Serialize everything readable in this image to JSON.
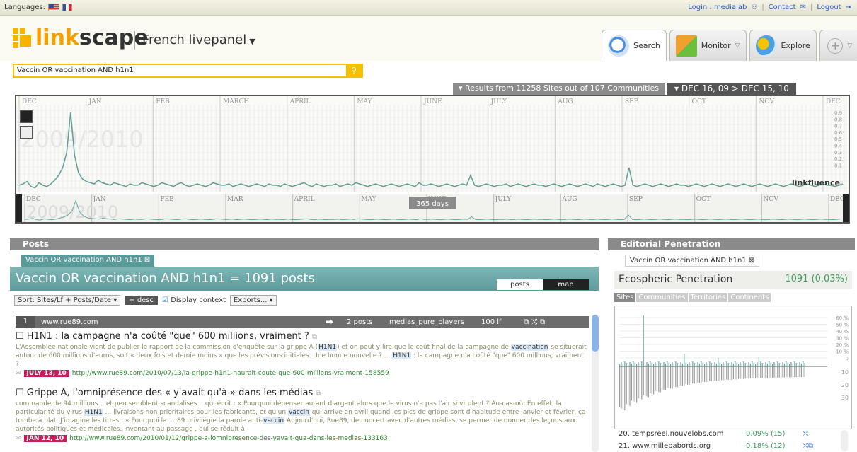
{
  "topbar": {
    "languages_label": "Languages:",
    "login": "Login : medialab",
    "contact": "Contact",
    "logout": "Logout",
    "separator": "|"
  },
  "header": {
    "logo_prefix": "link",
    "logo_suffix": "scape",
    "panel": "French livepanel",
    "tabs": [
      {
        "label": "Search"
      },
      {
        "label": "Monitor"
      },
      {
        "label": "Explore"
      }
    ]
  },
  "search": {
    "query": "Vaccin OR vaccination AND h1n1"
  },
  "results": {
    "summary": "Results from 11258 Sites out of 107 Communities",
    "date_range": "DEC 16, 09 > DEC 15, 10"
  },
  "timeline": {
    "months": [
      "DEC",
      "JAN",
      "FEB",
      "MARCH",
      "APRIL",
      "MAY",
      "JUNE",
      "JULY",
      "AUG",
      "SEP",
      "OCT",
      "NOV",
      "DEC"
    ],
    "mini_months": [
      "DEC",
      "JAN",
      "FEB",
      "MAR",
      "APRIL",
      "MAY",
      "JUNE",
      "JULY",
      "AUG",
      "SEP",
      "OCT",
      "NOV",
      "DEC"
    ],
    "year_watermark": "2009/2010",
    "mini_watermark": "2009/2010",
    "y_ticks": [
      "0.9",
      "0.8",
      "0.7",
      "0.6",
      "0.5",
      "0.4",
      "0.3",
      "0.2",
      "0.1"
    ],
    "brand": "linkfluence",
    "window_label": "365 days",
    "series": [
      4,
      5,
      7,
      3,
      2,
      6,
      4,
      3,
      5,
      8,
      12,
      18,
      30,
      62,
      28,
      14,
      9,
      7,
      6,
      5,
      8,
      6,
      5,
      4,
      6,
      5,
      4,
      3,
      5,
      4,
      4,
      6,
      5,
      4,
      3,
      4,
      6,
      5,
      4,
      3,
      5,
      6,
      4,
      3,
      4,
      5,
      4,
      3,
      4,
      6,
      5,
      4,
      4,
      5,
      3,
      4,
      5,
      4,
      3,
      4,
      5,
      4,
      3,
      5,
      4,
      4,
      3,
      5,
      4,
      3,
      4,
      5,
      6,
      4,
      3,
      5,
      4,
      3,
      4,
      4,
      5,
      3,
      4,
      5,
      4,
      6,
      5,
      4,
      3,
      4,
      5,
      4,
      3,
      4,
      5,
      4,
      3,
      4,
      5,
      4,
      3,
      6,
      4,
      4,
      5,
      4,
      3,
      4,
      5,
      4,
      3,
      4,
      5,
      4,
      12,
      4,
      3,
      4,
      5,
      4,
      3,
      4,
      4,
      5,
      3,
      4,
      5,
      4,
      3,
      4,
      5,
      4,
      4,
      3,
      4,
      5,
      4,
      3,
      4,
      5,
      4,
      3,
      4,
      5,
      4,
      3,
      5,
      4,
      3,
      4,
      5,
      4,
      3,
      4,
      18,
      4,
      3,
      4,
      5,
      4,
      3,
      4,
      5,
      4,
      3,
      4,
      5,
      4,
      4,
      3,
      4,
      5,
      4,
      3,
      4,
      5,
      4,
      3,
      4,
      5,
      4,
      3,
      4,
      5,
      4,
      3,
      4,
      5,
      4,
      3,
      4,
      5,
      4,
      3,
      4,
      5,
      4,
      3,
      4,
      5,
      4,
      3,
      4,
      5,
      4,
      4,
      3,
      4,
      5
    ]
  },
  "posts_panel": {
    "title": "Posts",
    "query_tab": "Vaccin OR vaccination AND h1n1",
    "banner": "Vaccin OR vaccination AND h1n1 = 1091 posts",
    "view_tabs": [
      "posts",
      "map"
    ],
    "sort": "Sort: Sites/Lf + Posts/Date",
    "desc": "+ desc",
    "display_context": "Display context",
    "exports": "Exports...",
    "site": {
      "rank": "1",
      "domain": "www.rue89.com",
      "posts": "2 posts",
      "category": "medias_pure_players",
      "lf": "100 lf"
    },
    "items": [
      {
        "title": "H1N1 : la campagne n'a coûté \"que\" 600 millions, vraiment ?",
        "body": "L'Assemblée nationale vient de publier le rapport de la commission d'enquête sur la grippe A (H1N1) et on peut y lire que le coût final de la campagne de vaccination se situerait autour de 600 millions d'euros, soit « deux fois et demie moins » que les prévisions initiales. Une bonne nouvelle ? ... H1N1 : la campagne n'a coûté \"que\" 600 millions, vraiment ?",
        "date": "JULY 13, 10",
        "url": "http://www.rue89.com/2010/07/13/la-grippe-h1n1-naurait-coute-que-600-millions-vraiment-158559"
      },
      {
        "title": "Grippe A, l'omniprésence des « y'avait qu'à » dans les médias",
        "body": "commande de 94 millions. , et peu semblent scandalisés. , qui écrit : « Pourquoi dépenser autant d'argent alors que le virus n'a pas l'air si virulent ? Au-cas-où. En effet, la particularité du virus H1N1 ... livraisons non prioritaires pour les fabricants, et qu'un vaccin qui arrive en avril quand les pics de grippe sont d'habitude entre janvier et février, ça tombe à plat. J'imagine les titres : « Pourquoi la ... 89 privilégie la parole anti-vaccin Aujourd'hui, Rue89, de concert avec d'autres médias, se permet de donner des leçons aux autorités politiques et médicales, inventant au passage , qui se réduit à",
        "date": "JAN 12, 10",
        "url": "http://www.rue89.com/2010/01/12/grippe-a-lomnipresence-des-yavait-qua-dans-les-medias-133163"
      }
    ]
  },
  "editorial": {
    "title": "Editorial Penetration",
    "query_tab": "Vaccin OR vaccination AND h1n1",
    "metric": "Ecospheric Penetration",
    "value": "1091 (0.03%)",
    "subtabs": [
      "Sites",
      "Communities",
      "Territories",
      "Continents"
    ],
    "y_pos_ticks": [
      "60 %",
      "50 %",
      "40 %",
      "30 %",
      "20 %",
      "10 %",
      "0"
    ],
    "y_neg_ticks": [
      "10",
      "20",
      "30"
    ],
    "rows": [
      {
        "name": "20. tempsreel.nouvelobs.com",
        "pct": "0.09% (15)"
      },
      {
        "name": "21. www.millebabords.org",
        "pct": "0.18% (12)"
      }
    ]
  }
}
